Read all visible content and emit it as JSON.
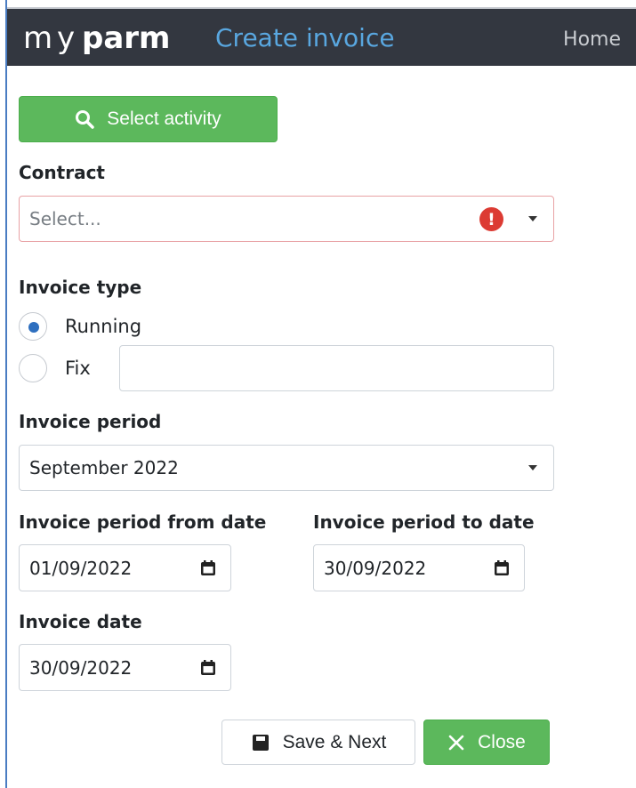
{
  "app": {
    "logo": "myparm",
    "title": "Create invoice",
    "nav_home": "Home"
  },
  "actions": {
    "select_activity": "Select activity",
    "save_next": "Save & Next",
    "close": "Close"
  },
  "contract": {
    "label": "Contract",
    "placeholder": "Select...",
    "error_symbol": "!"
  },
  "invoice_type": {
    "label": "Invoice type",
    "options": [
      {
        "label": "Running",
        "checked": true
      },
      {
        "label": "Fix",
        "checked": false
      }
    ],
    "fix_value": ""
  },
  "invoice_period": {
    "label": "Invoice period",
    "value": "September 2022"
  },
  "period_from": {
    "label": "Invoice period from date",
    "value": "01/09/2022"
  },
  "period_to": {
    "label": "Invoice period to date",
    "value": "30/09/2022"
  },
  "invoice_date": {
    "label": "Invoice date",
    "value": "30/09/2022"
  },
  "colors": {
    "primary_green": "#5cb85c",
    "header_bg": "#333740",
    "title_blue": "#59a7e0",
    "error_red": "#dc3b33",
    "radio_blue": "#2e6fbf"
  }
}
